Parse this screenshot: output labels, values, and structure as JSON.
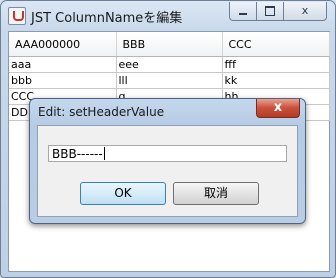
{
  "window": {
    "title": "JST ColumnNameを編集",
    "minimize_label": "",
    "maximize_label": "",
    "close_label": "x"
  },
  "table": {
    "headers": [
      "AAA000000",
      "BBB",
      "CCC"
    ],
    "rows": [
      [
        "aaa",
        "eee",
        "fff"
      ],
      [
        "bbb",
        "lll",
        "kk"
      ],
      [
        "CCC",
        "g",
        "hh"
      ],
      [
        "DDD",
        "",
        ""
      ]
    ]
  },
  "dialog": {
    "title": "Edit: setHeaderValue",
    "close_label": "x",
    "input_value": "BBB------",
    "ok_label": "OK",
    "cancel_label": "取消"
  }
}
